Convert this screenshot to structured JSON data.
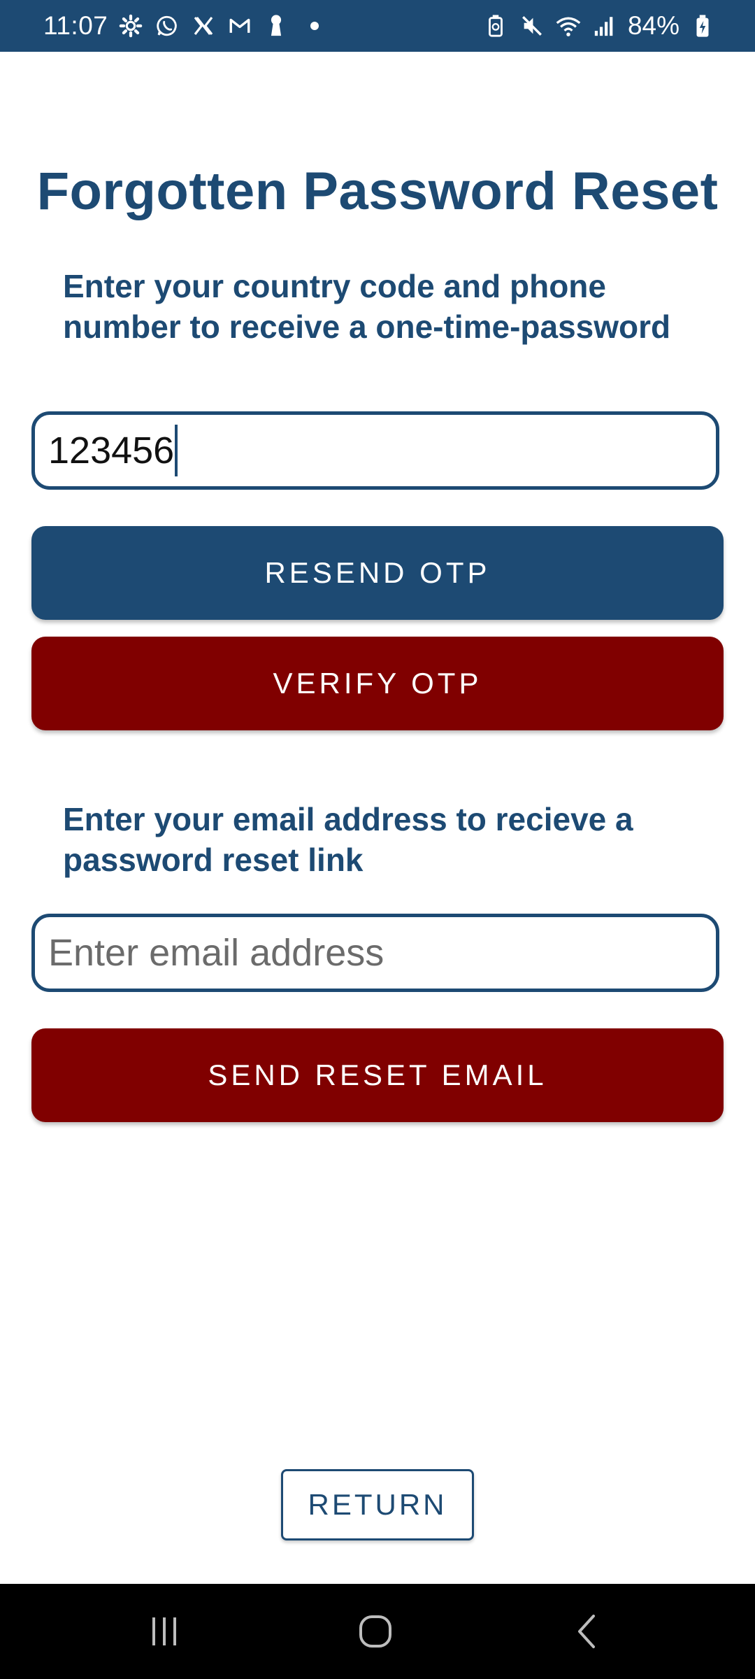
{
  "status_bar": {
    "time": "11:07",
    "battery": "84%",
    "left_icons": [
      "gear-icon",
      "whatsapp-icon",
      "x-icon",
      "gmail-icon",
      "keyhole-icon",
      "dot-icon"
    ],
    "right_icons": [
      "battery-saver-icon",
      "mute-icon",
      "wifi-icon",
      "signal-icon",
      "battery-charging-icon"
    ]
  },
  "page": {
    "title": "Forgotten Password Reset",
    "phone_instruction": "Enter your country code and phone number to receive a one-time-password",
    "phone_value": "123456",
    "resend_label": "RESEND OTP",
    "verify_label": "VERIFY OTP",
    "email_instruction": "Enter your email address to recieve a password reset link",
    "email_placeholder": "Enter email address",
    "send_label": "SEND RESET EMAIL",
    "return_label": "RETURN"
  },
  "colors": {
    "primary_blue": "#1d4a73",
    "dark_red": "#800000",
    "background": "#ffffff",
    "nav_bar": "#000000"
  }
}
